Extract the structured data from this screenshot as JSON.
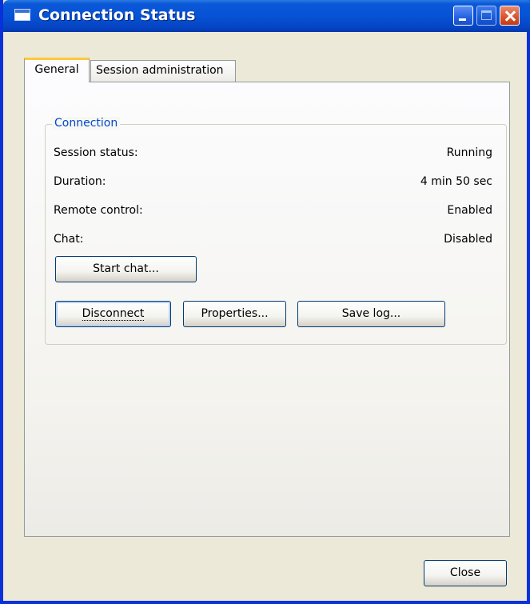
{
  "window": {
    "title": "Connection Status"
  },
  "tabs": [
    {
      "label": "General",
      "active": true
    },
    {
      "label": "Session administration",
      "active": false
    }
  ],
  "connection": {
    "group_title": "Connection",
    "rows": [
      {
        "label": "Session status:",
        "value": "Running"
      },
      {
        "label": "Duration:",
        "value": "4 min 50 sec"
      },
      {
        "label": "Remote control:",
        "value": "Enabled"
      },
      {
        "label": "Chat:",
        "value": "Disabled"
      }
    ],
    "start_chat_label": "Start chat...",
    "disconnect_label": "Disconnect",
    "properties_label": "Properties...",
    "save_log_label": "Save log..."
  },
  "footer": {
    "close_label": "Close"
  },
  "colors": {
    "titlebar": "#0653d6",
    "accent": "#0046d5",
    "tab_highlight": "#ffc83c"
  }
}
